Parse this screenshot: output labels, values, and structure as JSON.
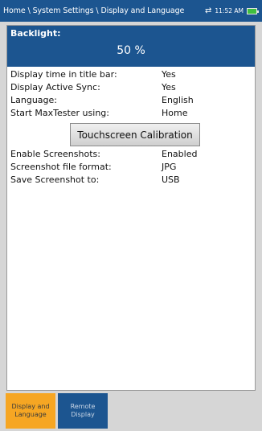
{
  "header": {
    "breadcrumb": "Home \\ System Settings \\ Display and Language",
    "time": "11:52 AM",
    "sync_icon": "sync-arrows-icon",
    "battery_icon": "battery-icon"
  },
  "backlight": {
    "label": "Backlight:",
    "value": "50 %"
  },
  "settings": {
    "display_time": {
      "label": "Display time in title bar:",
      "value": "Yes"
    },
    "active_sync": {
      "label": "Display Active Sync:",
      "value": "Yes"
    },
    "language": {
      "label": "Language:",
      "value": "English"
    },
    "start_using": {
      "label": "Start MaxTester using:",
      "value": "Home"
    },
    "calibration_button": "Touchscreen Calibration",
    "enable_screenshots": {
      "label": "Enable Screenshots:",
      "value": "Enabled"
    },
    "file_format": {
      "label": "Screenshot file format:",
      "value": "JPG"
    },
    "save_to": {
      "label": "Save Screenshot to:",
      "value": "USB"
    }
  },
  "tabs": [
    {
      "label": "Display and\nLanguage",
      "active": true
    },
    {
      "label": "Remote\nDisplay",
      "active": false
    }
  ],
  "colors": {
    "header_blue": "#1c5590",
    "active_tab": "#f6a623",
    "battery_green": "#3fbf3f"
  }
}
